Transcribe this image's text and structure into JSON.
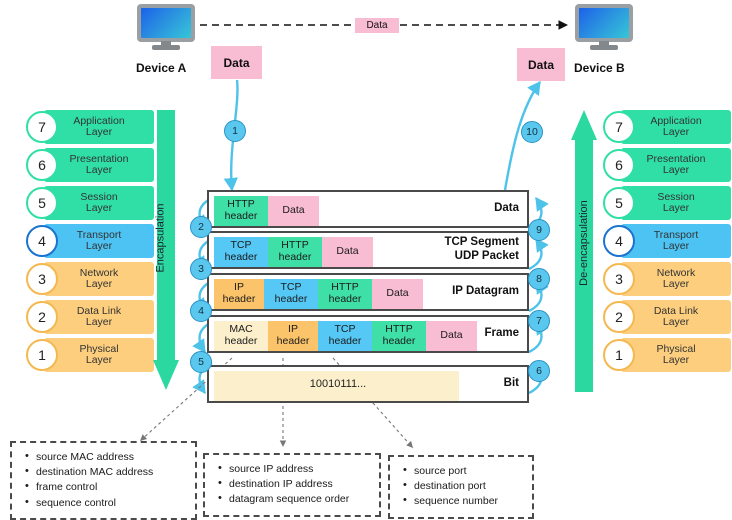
{
  "devices": {
    "left": {
      "label": "Device A",
      "icon": "monitor-icon"
    },
    "right": {
      "label": "Device B",
      "icon": "monitor-icon"
    }
  },
  "top_link": {
    "label": "Data",
    "style": "dashed-arrow",
    "direction": "left-to-right"
  },
  "data_chips": {
    "source": "Data",
    "destination": "Data"
  },
  "flow_labels": {
    "encapsulation": "Encapsulation",
    "de_encapsulation": "De-encapsulation"
  },
  "colors": {
    "green": "#2fdfa5",
    "blue": "#4cc3f2",
    "amber": "#fcce7e",
    "pink": "#f9bdd3",
    "cream": "#fcefcb",
    "step_circle": "#5ac8ee",
    "arrow_green": "#2bd9a0",
    "curve_arrow": "#4ec3ea"
  },
  "osi_layers": [
    {
      "number": "7",
      "name": "Application Layer",
      "line1": "Application",
      "line2": "Layer",
      "color": "green"
    },
    {
      "number": "6",
      "name": "Presentation Layer",
      "line1": "Presentation",
      "line2": "Layer",
      "color": "green"
    },
    {
      "number": "5",
      "name": "Session Layer",
      "line1": "Session",
      "line2": "Layer",
      "color": "green"
    },
    {
      "number": "4",
      "name": "Transport Layer",
      "line1": "Transport",
      "line2": "Layer",
      "color": "blue"
    },
    {
      "number": "3",
      "name": "Network Layer",
      "line1": "Network",
      "line2": "Layer",
      "color": "amber"
    },
    {
      "number": "2",
      "name": "Data Link Layer",
      "line1": "Data Link",
      "line2": "Layer",
      "color": "amber"
    },
    {
      "number": "1",
      "name": "Physical Layer",
      "line1": "Physical",
      "line2": "Layer",
      "color": "amber"
    }
  ],
  "pdu_rows": [
    {
      "pdu_name_line1": "Data",
      "pdu_name_line2": "",
      "segments": [
        {
          "line1": "HTTP",
          "line2": "header",
          "color": "green"
        },
        {
          "line1": "Data",
          "line2": "",
          "color": "pink"
        }
      ]
    },
    {
      "pdu_name_line1": "TCP Segment",
      "pdu_name_line2": "UDP Packet",
      "segments": [
        {
          "line1": "TCP",
          "line2": "header",
          "color": "blue"
        },
        {
          "line1": "HTTP",
          "line2": "header",
          "color": "green"
        },
        {
          "line1": "Data",
          "line2": "",
          "color": "pink"
        }
      ]
    },
    {
      "pdu_name_line1": "IP Datagram",
      "pdu_name_line2": "",
      "segments": [
        {
          "line1": "IP",
          "line2": "header",
          "color": "amber"
        },
        {
          "line1": "TCP",
          "line2": "header",
          "color": "blue"
        },
        {
          "line1": "HTTP",
          "line2": "header",
          "color": "green"
        },
        {
          "line1": "Data",
          "line2": "",
          "color": "pink"
        }
      ]
    },
    {
      "pdu_name_line1": "Frame",
      "pdu_name_line2": "",
      "segments": [
        {
          "line1": "MAC",
          "line2": "header",
          "color": "cream"
        },
        {
          "line1": "IP",
          "line2": "header",
          "color": "amber"
        },
        {
          "line1": "TCP",
          "line2": "header",
          "color": "blue"
        },
        {
          "line1": "HTTP",
          "line2": "header",
          "color": "green"
        },
        {
          "line1": "Data",
          "line2": "",
          "color": "pink"
        }
      ]
    },
    {
      "pdu_name_line1": "Bit",
      "pdu_name_line2": "",
      "bits": "10010111...",
      "segments": []
    }
  ],
  "steps": {
    "encapsulation": [
      "1",
      "2",
      "3",
      "4",
      "5"
    ],
    "de_encapsulation": [
      "6",
      "7",
      "8",
      "9",
      "10"
    ]
  },
  "callouts": [
    {
      "source": "MAC header",
      "items": [
        "source MAC address",
        "destination MAC address",
        "frame control",
        "sequence control"
      ]
    },
    {
      "source": "IP header",
      "items": [
        "source IP address",
        "destination IP address",
        "datagram sequence order"
      ]
    },
    {
      "source": "TCP header",
      "items": [
        "source port",
        "destination port",
        "sequence number"
      ]
    }
  ]
}
